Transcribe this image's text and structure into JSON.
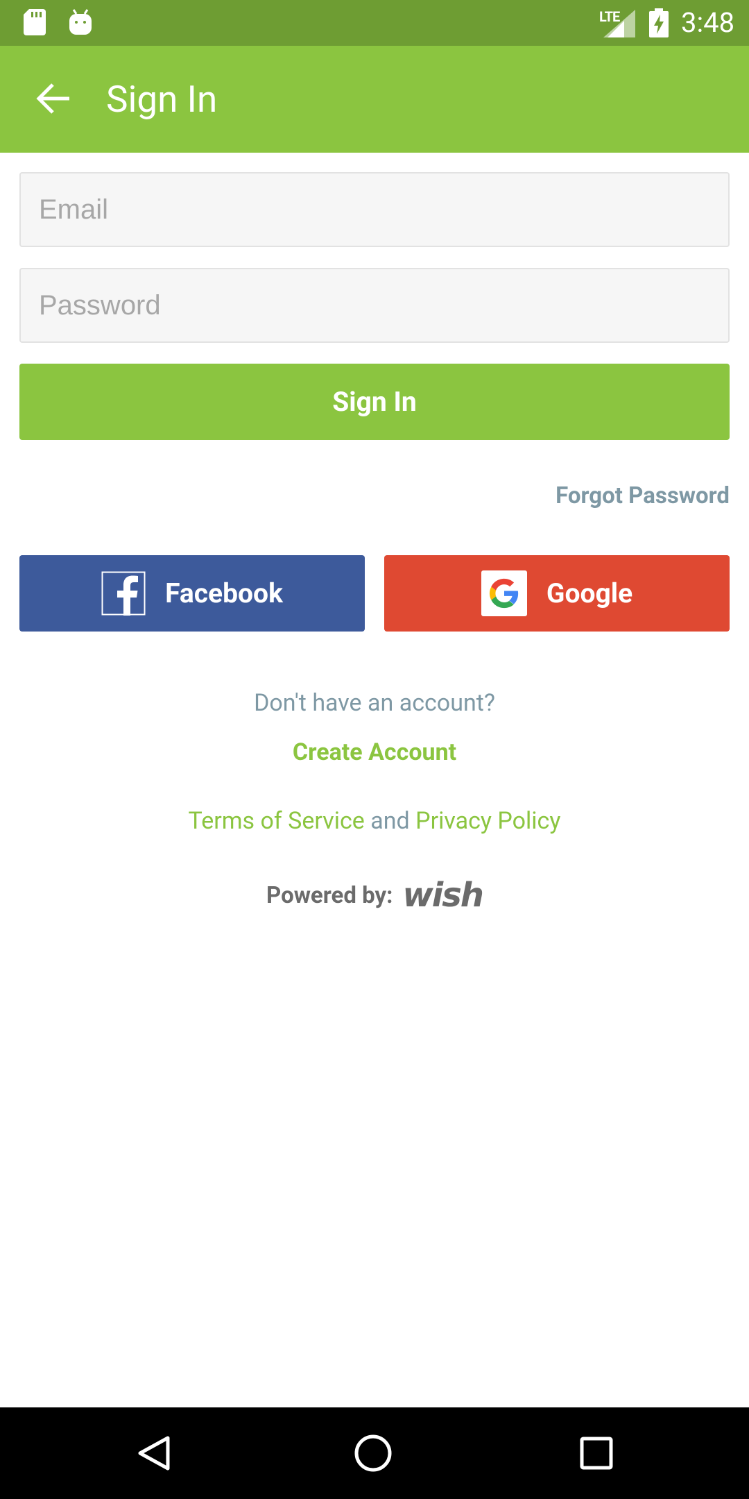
{
  "status_bar": {
    "network": "LTE",
    "time": "3:48"
  },
  "app_bar": {
    "title": "Sign In"
  },
  "form": {
    "email_placeholder": "Email",
    "password_placeholder": "Password",
    "sign_in_label": "Sign In",
    "forgot_label": "Forgot Password"
  },
  "social": {
    "facebook_label": "Facebook",
    "google_label": "Google"
  },
  "footer": {
    "no_account": "Don't have an account?",
    "create_account": "Create Account",
    "terms": "Terms of Service",
    "and": "and",
    "privacy": "Privacy Policy",
    "powered_by": "Powered by:",
    "brand": "wish"
  },
  "colors": {
    "status_bar": "#6e9d33",
    "accent": "#8bc540",
    "facebook": "#3d5a9b",
    "google": "#df4932",
    "muted_text": "#7e98a4"
  }
}
